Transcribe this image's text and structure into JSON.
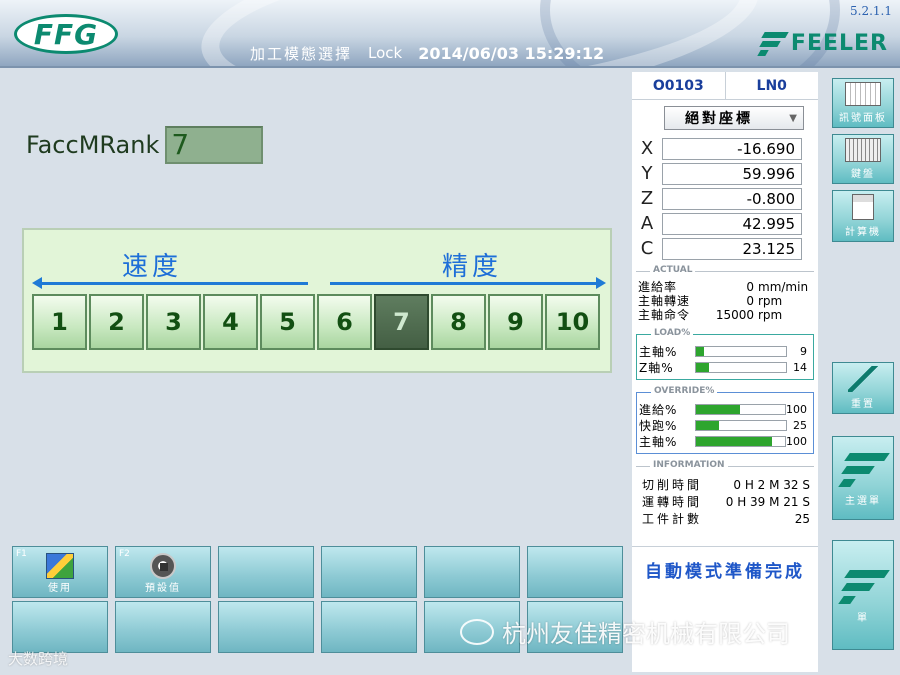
{
  "header": {
    "mode_title": "加工模態選擇",
    "lock_label": "Lock",
    "datetime": "2014/06/03 15:29:12",
    "version": "5.2.1.1",
    "logo_left": "FFG",
    "logo_right": "FEELER"
  },
  "rank": {
    "label": "FaccMRank",
    "value": "7",
    "speed_label": "速度",
    "precision_label": "精度",
    "buttons": [
      "1",
      "2",
      "3",
      "4",
      "5",
      "6",
      "7",
      "8",
      "9",
      "10"
    ],
    "selected": "7"
  },
  "function_keys": [
    {
      "num": "F1",
      "label": "使用",
      "icon": "edit-icon"
    },
    {
      "num": "F2",
      "label": "預設值",
      "icon": "stop-icon"
    }
  ],
  "status": {
    "program": "O0103",
    "line": "LN0",
    "coordinate_mode": "絕對座標",
    "axes": [
      {
        "axis": "X",
        "value": "-16.690"
      },
      {
        "axis": "Y",
        "value": "59.996"
      },
      {
        "axis": "Z",
        "value": "-0.800"
      },
      {
        "axis": "A",
        "value": "42.995"
      },
      {
        "axis": "C",
        "value": "23.125"
      }
    ],
    "actual": {
      "title": "ACTUAL",
      "rows": [
        {
          "k": "進給率",
          "v": "0",
          "u": "mm/min"
        },
        {
          "k": "主軸轉速",
          "v": "0",
          "u": "rpm"
        },
        {
          "k": "主軸命令",
          "v": "15000",
          "u": "rpm"
        }
      ]
    },
    "load": {
      "title": "LOAD%",
      "rows": [
        {
          "k": "主軸%",
          "v": "9",
          "pct": 9
        },
        {
          "k": "Z軸%",
          "v": "14",
          "pct": 14
        }
      ]
    },
    "override": {
      "title": "OVERRIDE%",
      "rows": [
        {
          "k": "進給%",
          "v": "100",
          "pct": 50
        },
        {
          "k": "快跑%",
          "v": "25",
          "pct": 25
        },
        {
          "k": "主軸%",
          "v": "100",
          "pct": 85
        }
      ]
    },
    "information": {
      "title": "INFORMATION",
      "rows": [
        {
          "k": "切削時間",
          "v": "0 H  2 M 32 S"
        },
        {
          "k": "運轉時間",
          "v": "0 H 39 M 21 S"
        },
        {
          "k": "工件計數",
          "v": "25"
        }
      ]
    },
    "mode_message": "自動模式準備完成"
  },
  "side_buttons": [
    {
      "label": "訊號面板",
      "icon": "panel-icon"
    },
    {
      "label": "鍵盤",
      "icon": "keyboard-icon"
    },
    {
      "label": "計算機",
      "icon": "calculator-icon"
    },
    {
      "label": "重置",
      "icon": "reset-icon"
    },
    {
      "label": "主選單",
      "icon": "menu-icon"
    },
    {
      "label": "單",
      "icon": "logo-icon"
    }
  ],
  "watermark": {
    "company": "杭州友佳精密机械有限公司",
    "source": "大数跨境"
  },
  "colors": {
    "accent_green": "#0c8a70",
    "rank_active": "#445f44",
    "status_blue": "#1f57c8",
    "bar_green": "#2ea52e"
  }
}
